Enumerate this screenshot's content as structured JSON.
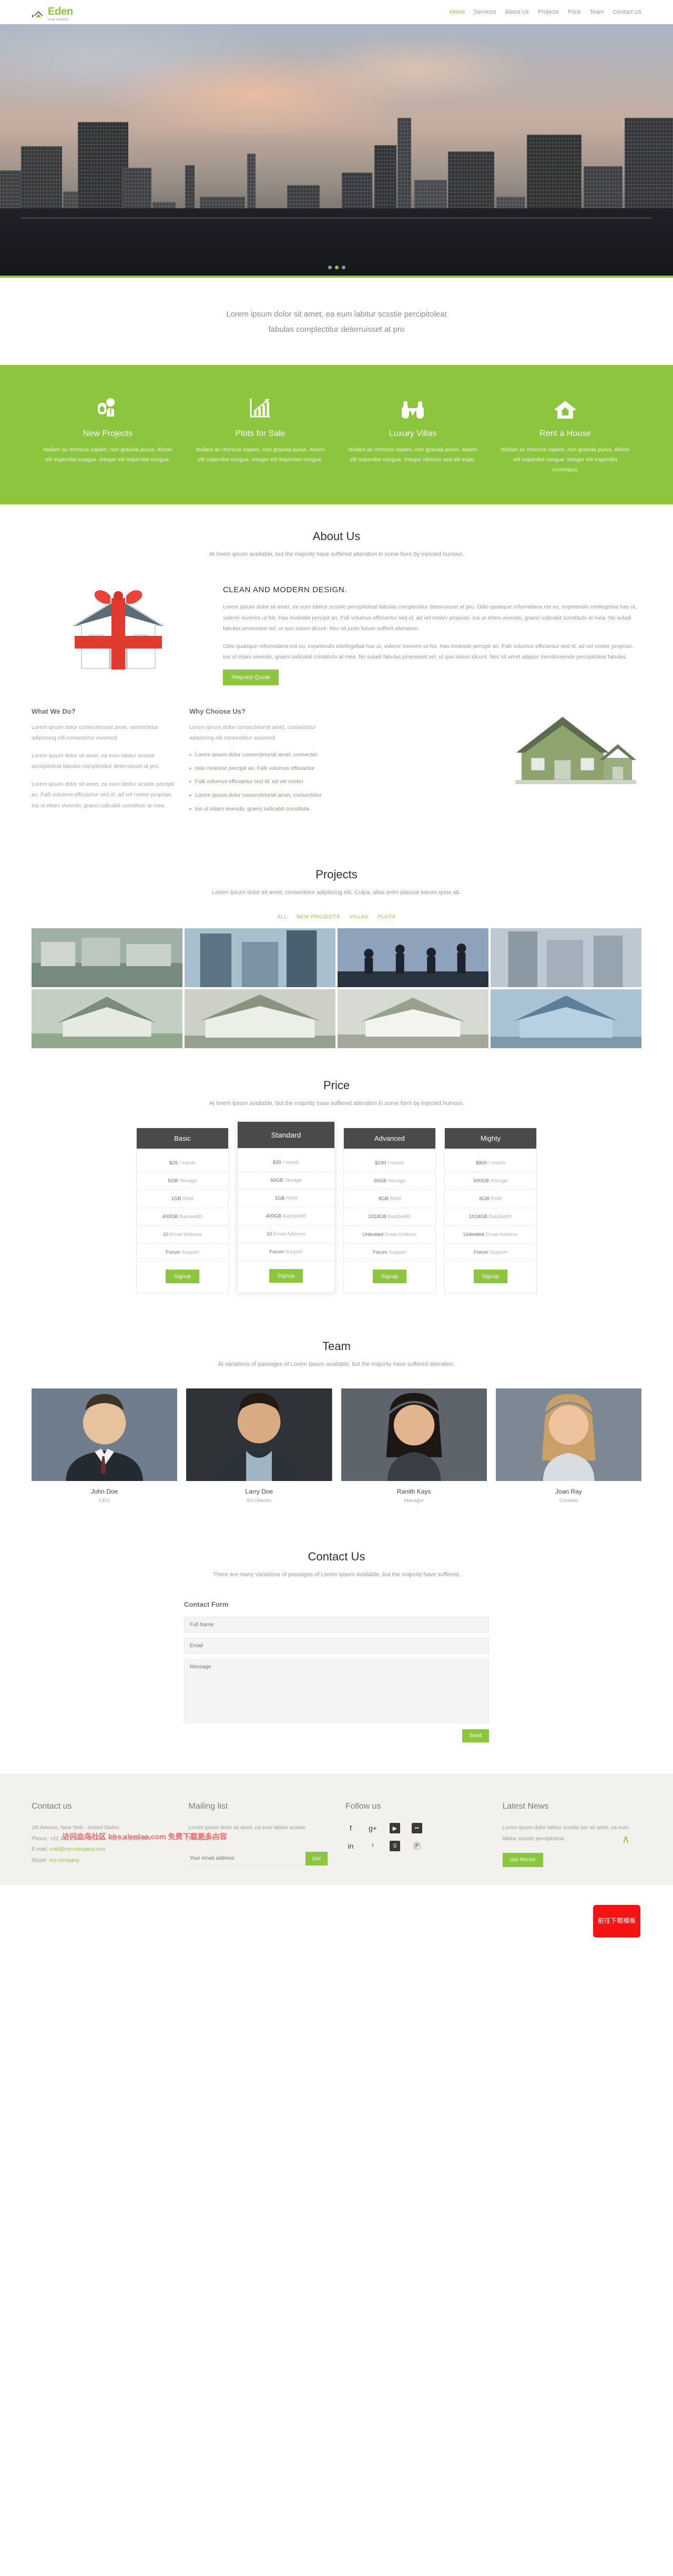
{
  "brand": {
    "name": "Eden",
    "tagline": "real estate",
    "accent": "#8CC63E",
    "logo_icon": "house-roof-icon"
  },
  "nav": {
    "items": [
      {
        "label": "Home",
        "active": true
      },
      {
        "label": "Services",
        "active": false
      },
      {
        "label": "About Us",
        "active": false
      },
      {
        "label": "Projects",
        "active": false
      },
      {
        "label": "Price",
        "active": false
      },
      {
        "label": "Team",
        "active": false
      },
      {
        "label": "Contact Us",
        "active": false
      }
    ]
  },
  "hero": {
    "alt": "city skyline at dusk with rooftop terrace",
    "slide_count": 3,
    "active_slide": 2
  },
  "tagline": {
    "line1": "Lorem ipsum dolor sit amet, ea eum labitur scsstie percipitoleat",
    "line2": "fabulas complectitur deterruisset at pro"
  },
  "services": {
    "items": [
      {
        "icon": "agent-house-icon",
        "title": "New Projects",
        "desc": "Nullam ac rhoncus sapien, non gravida purus. Alinon elit imperdiet congue. Integer elit imperdiet congue."
      },
      {
        "icon": "bar-chart-growth-icon",
        "title": "Plots for Sale",
        "desc": "Nullam ac rhoncus sapien, non gravida purus. Alinon elit imperdiet congue. Integer elit imperdiet congue."
      },
      {
        "icon": "binoculars-icon",
        "title": "Luxury Villas",
        "desc": "Nullam ac rhoncus sapien, non gravida purus. Alinon elit imperdiet congue. Integer ultricies sed elit impe."
      },
      {
        "icon": "home-icon",
        "title": "Rent a House",
        "desc": "Nullam ac rhoncus sapien, non gravida purus. Alinon elit imperdiet congue. Integer elit imperdiet conempus."
      }
    ]
  },
  "about": {
    "heading": "About Us",
    "subheading": "At lorem ipsum available, but the majority have suffered alteration in some form by injected humour.",
    "image_alt": "house wrapped with a red gift ribbon",
    "title": "CLEAN AND MODERN DESIGN.",
    "para1": "Lorem ipsum dolor sit amet, ea eum labitur scsstie percipitoleat fabulas complectitur deterruisset at pro. Odio quaeque reformidans est eu, expetendis intellegebat has ut, viderer invenire ut his. Has molestie percipit an. Fall volumus efficiantur sed id, ad vel noster propriae. Ius ut etiam vivendo, graeci iudicabit constituto at mea. No suladi fabulas proeseant vel, ut quo solum dicunt. Nec sit justo fuisse sufferit alteration.",
    "para2": "Odio quaeque reformidans est eu, expetendis intellegebat has ut, viderer invenire ut his. Has molestie percipit an. Falli volumus efficiantur sed id, ad vel noster propriae. Ius ut etiam vivendo, graeci iudicabit constituto at mea. No suladi fabulas proeseant vel, ut quo solum dicunt. Nec sit amet adipisc mentiluniende percipitoleat fabulas.",
    "cta": "Request Quote"
  },
  "what_we_do": {
    "title": "What We Do?",
    "para1": "Lorem ipsum dolor consectetursit amet, consectetur adipiscing elit consectetur euismod",
    "para2": "Lorem ipsum dolor sit amet, ea eum labitur scsstie percipitoleat fabulas complectitur deterruisset at pro.",
    "para3": "Lorem ipsum dolor sit amet, ea eum labitur scsstie percipit an. Falli volumus efficiantur sed id, ad vel noster propriae. Ius ut etiam vivendo, graeci iudicabit constituto at mea."
  },
  "why_choose_us": {
    "title": "Why Choose Us?",
    "intro": "Lorem ipsum dolor consectetursit amet, consectetur adipiscing elit consectetur euismod",
    "bullets": [
      "Lorem ipsum dolor consectetursit amet, consectet",
      "Has molestie percipit an. Falli volumus efficiantur",
      "Falli volumus efficiantur sed id, ad vel noster",
      "Lorem ipsum dolor consectetursit amet, consectetur",
      "Ius ut etiam vivendo, graeci iudicabit constituta"
    ],
    "image_alt": "green suburban house rendering"
  },
  "projects": {
    "heading": "Projects",
    "subheading": "Lorem ipsum dolor sit amet, consectetur adipiscing elit. Culpa, alias enim placeat earum quos ab.",
    "filters": [
      {
        "label": "ALL",
        "active": true
      },
      {
        "label": "NEW PROJECTS",
        "active": false
      },
      {
        "label": "VILLAS",
        "active": false
      },
      {
        "label": "PLOTS",
        "active": false
      }
    ],
    "tiles": [
      {
        "alt": "apartment block row",
        "c1": "#a7b5ae",
        "c2": "#6e7c74"
      },
      {
        "alt": "glass office tower",
        "c1": "#9fb6c4",
        "c2": "#5c7386"
      },
      {
        "alt": "silhouette of people jumping at sunset",
        "c1": "#8a9bb4",
        "c2": "#2c3340"
      },
      {
        "alt": "modern residential highrise",
        "c1": "#b0bcc6",
        "c2": "#7a8a96"
      },
      {
        "alt": "suburban house with lawn",
        "c1": "#b9c3b3",
        "c2": "#7f8d7e"
      },
      {
        "alt": "family home exterior",
        "c1": "#c3c7bd",
        "c2": "#868b80"
      },
      {
        "alt": "white cottage with garden",
        "c1": "#cdd2c9",
        "c2": "#8f968c"
      },
      {
        "alt": "blue wooden house",
        "c1": "#9fb9cd",
        "c2": "#5d7f9a"
      }
    ]
  },
  "price": {
    "heading": "Price",
    "subheading": "At lorem ipsum available, but the majority have suffered alteration in some form by injected humour.",
    "plans": [
      {
        "name": "Basic",
        "featured": false,
        "rows": [
          {
            "value": "$29",
            "label": "/ month"
          },
          {
            "value": "5GB",
            "label": "Storage"
          },
          {
            "value": "1GB",
            "label": "RAM"
          },
          {
            "value": "400GB",
            "label": "Bandwidth"
          },
          {
            "value": "10",
            "label": "Email Address"
          },
          {
            "value": "Forum",
            "label": "Support"
          }
        ],
        "cta": "Signup"
      },
      {
        "name": "Standard",
        "featured": true,
        "rows": [
          {
            "value": "$39",
            "label": "/ month"
          },
          {
            "value": "50GB",
            "label": "Storage"
          },
          {
            "value": "1GB",
            "label": "RAM"
          },
          {
            "value": "400GB",
            "label": "Bandwidth"
          },
          {
            "value": "10",
            "label": "Email Address"
          },
          {
            "value": "Forum",
            "label": "Support"
          }
        ],
        "cta": "Signup"
      },
      {
        "name": "Advanced",
        "featured": false,
        "rows": [
          {
            "value": "$190",
            "label": "/ month"
          },
          {
            "value": "90GB",
            "label": "Storage"
          },
          {
            "value": "8GB",
            "label": "RAM"
          },
          {
            "value": "1024GB",
            "label": "Bandwidth"
          },
          {
            "value": "Unlimited",
            "label": "Email Address"
          },
          {
            "value": "Forum",
            "label": "Support"
          }
        ],
        "cta": "Signup"
      },
      {
        "name": "Mighty",
        "featured": false,
        "rows": [
          {
            "value": "$900",
            "label": "/ month"
          },
          {
            "value": "500GB",
            "label": "Storage"
          },
          {
            "value": "8GB",
            "label": "RAM"
          },
          {
            "value": "1024GB",
            "label": "Bandwidth"
          },
          {
            "value": "Unlimited",
            "label": "Email Address"
          },
          {
            "value": "Forum",
            "label": "Support"
          }
        ],
        "cta": "Signup"
      }
    ]
  },
  "team": {
    "heading": "Team",
    "subheading": "At variations of passages of Lorem Ipsum available, but the majority have suffered alteration.",
    "members": [
      {
        "name": "John Doe",
        "role": "CEO",
        "alt": "man in dark suit smiling"
      },
      {
        "name": "Larry Doe",
        "role": "Art Director",
        "alt": "man in blue shirt and jacket"
      },
      {
        "name": "Ranith Kays",
        "role": "Manager",
        "alt": "woman with long dark hair"
      },
      {
        "name": "Joan Ray",
        "role": "Creative",
        "alt": "blonde woman smiling"
      }
    ]
  },
  "contact": {
    "heading": "Contact Us",
    "subheading": "There are many variations of passages of Lorem Ipsum available, but the majority have suffered.",
    "form_title": "Contact Form",
    "fullname_placeholder": "Full Name",
    "email_placeholder": "Email",
    "message_placeholder": "Message",
    "send_label": "Send"
  },
  "footer": {
    "contact": {
      "title": "Contact us",
      "address": "1th Avenue, New York - United States",
      "phone": "Phone: +22 342 2345 345 | Fax: +22 724 2342 343",
      "email_label": "E-mail:",
      "email_value": "mail@my-company.com",
      "skype_label": "Skype:",
      "skype_value": "my-company"
    },
    "mailing": {
      "title": "Mailing list",
      "desc": "Lorem ipsum dolor sit amet, ea eum labitur scsstie percipitoleat.",
      "placeholder": "Your email address",
      "button": "Go!"
    },
    "follow": {
      "title": "Follow us",
      "icons": [
        {
          "name": "facebook-icon",
          "glyph": "f",
          "boxed": false
        },
        {
          "name": "google-plus-icon",
          "glyph": "g+",
          "boxed": false
        },
        {
          "name": "youtube-icon",
          "glyph": "▶",
          "boxed": true
        },
        {
          "name": "flickr-icon",
          "glyph": "••",
          "boxed": true
        },
        {
          "name": "linkedin-icon",
          "glyph": "in",
          "boxed": false
        },
        {
          "name": "twitter-icon",
          "glyph": "ᵗ",
          "boxed": false
        },
        {
          "name": "skype-icon",
          "glyph": "S",
          "boxed": true
        },
        {
          "name": "pinterest-icon",
          "glyph": "Ⓟ",
          "boxed": false
        }
      ]
    },
    "news": {
      "title": "Latest News",
      "desc": "Lorem ipsum dolor labitur scsstie per sit amet, ea eum labitur scsstie percipitoleat.",
      "button": "Get Mores!"
    }
  },
  "watermarks": {
    "red_button": "前往下载模板",
    "banner": "访问血鸟社区 bbs.xlenlao.com 免费下载更多内容",
    "to_top": "∧"
  }
}
